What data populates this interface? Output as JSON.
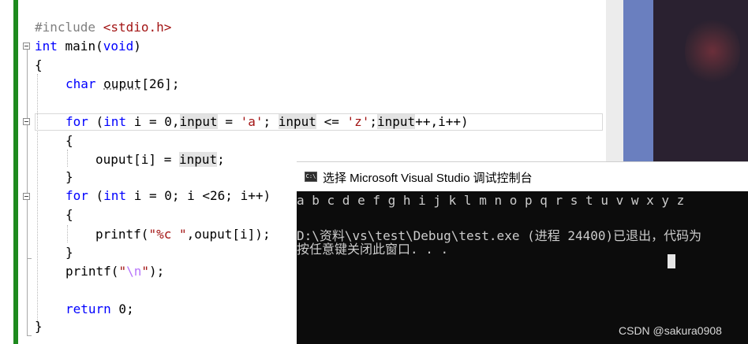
{
  "editor": {
    "lines": {
      "l1_pp": "#include",
      "l1_hdr": "<stdio.h>",
      "l2_kw": "int",
      "l2_rest": " main(",
      "l2_kw2": "void",
      "l2_end": ")",
      "l3": "{",
      "l4_kw": "char",
      "l4_var": "ouput",
      "l4_rest": "[26];",
      "l6_kw": "for",
      "l6_a": " (",
      "l6_kw2": "int",
      "l6_b": " i = 0,",
      "l6_in1": "input",
      "l6_c": " = ",
      "l6_s1": "'a'",
      "l6_d": "; ",
      "l6_in2": "input",
      "l6_e": " <= ",
      "l6_s2": "'z'",
      "l6_f": ";",
      "l6_in3": "input",
      "l6_g": "++,i++)",
      "l7": "{",
      "l8_a": "ouput[i] = ",
      "l8_in": "input",
      "l8_b": ";",
      "l9": "}",
      "l10_kw": "for",
      "l10_a": " (",
      "l10_kw2": "int",
      "l10_b": " i = 0; i <26; i++)",
      "l11": "{",
      "l12_a": "printf(",
      "l12_s1": "\"%c \"",
      "l12_b": ",ouput[i]);",
      "l13": "}",
      "l14_a": "printf(",
      "l14_s1": "\"",
      "l14_esc": "\\n",
      "l14_s2": "\"",
      "l14_b": ");",
      "l16_kw": "return",
      "l16_b": " 0;",
      "l17": "}"
    }
  },
  "console": {
    "title": "选择 Microsoft Visual Studio 调试控制台",
    "icon_text": "C:\\",
    "icon": "console-app-icon",
    "output_line1": "a b c d e f g h i j k l m n o p q r s t u v w x y z",
    "output_line2": "",
    "output_line3": "D:\\资料\\vs\\test\\Debug\\test.exe (进程 24400)已退出，代码为",
    "output_line4": "按任意键关闭此窗口. . .",
    "watermark": "CSDN @sakura0908"
  },
  "colors": {
    "keyword": "#0000ff",
    "string": "#a31515",
    "preprocessor": "#808080",
    "escape": "#b776fb",
    "change_bar": "#1e8a1e",
    "console_bg": "#0c0c0c"
  }
}
